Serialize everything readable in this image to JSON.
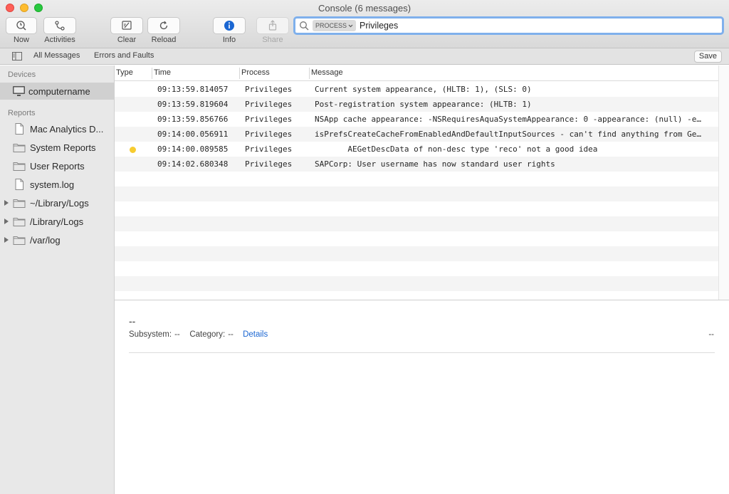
{
  "window": {
    "title": "Console (6 messages)"
  },
  "toolbar": {
    "now": "Now",
    "activities": "Activities",
    "clear": "Clear",
    "reload": "Reload",
    "info": "Info",
    "share": "Share"
  },
  "search": {
    "token": "PROCESS",
    "value": "Privileges"
  },
  "filterbar": {
    "all_messages": "All Messages",
    "errors_and_faults": "Errors and Faults",
    "save": "Save"
  },
  "sidebar": {
    "devices_header": "Devices",
    "device": "computername",
    "reports_header": "Reports",
    "items": [
      {
        "label": "Mac Analytics D..."
      },
      {
        "label": "System Reports"
      },
      {
        "label": "User Reports"
      },
      {
        "label": "system.log"
      },
      {
        "label": "~/Library/Logs"
      },
      {
        "label": "/Library/Logs"
      },
      {
        "label": "/var/log"
      }
    ]
  },
  "table": {
    "columns": {
      "type": "Type",
      "time": "Time",
      "process": "Process",
      "message": "Message"
    },
    "rows": [
      {
        "type": "",
        "time": "09:13:59.814057",
        "process": "Privileges",
        "message": "Current system appearance, (HLTB: 1), (SLS: 0)"
      },
      {
        "type": "",
        "time": "09:13:59.819604",
        "process": "Privileges",
        "message": "Post-registration system appearance: (HLTB: 1)"
      },
      {
        "type": "",
        "time": "09:13:59.856766",
        "process": "Privileges",
        "message": "NSApp cache appearance: -NSRequiresAquaSystemAppearance: 0 -appearance: (null) -e…"
      },
      {
        "type": "",
        "time": "09:14:00.056911",
        "process": "Privileges",
        "message": "isPrefsCreateCacheFromEnabledAndDefaultInputSources - can't find anything from Ge…"
      },
      {
        "type": "default",
        "time": "09:14:00.089585",
        "process": "Privileges",
        "message": "       AEGetDescData of non-desc type 'reco' not a good idea"
      },
      {
        "type": "",
        "time": "09:14:02.680348",
        "process": "Privileges",
        "message": "SAPCorp: User username has now standard user rights"
      }
    ]
  },
  "detail": {
    "title": "--",
    "subsystem_label": "Subsystem:",
    "subsystem_value": "--",
    "category_label": "Category:",
    "category_value": "--",
    "details_link": "Details",
    "right_value": "--"
  },
  "colors": {
    "accent": "#1a66d2",
    "dot_default": "#f7cc30",
    "search_focus": "#7fb0ec"
  }
}
